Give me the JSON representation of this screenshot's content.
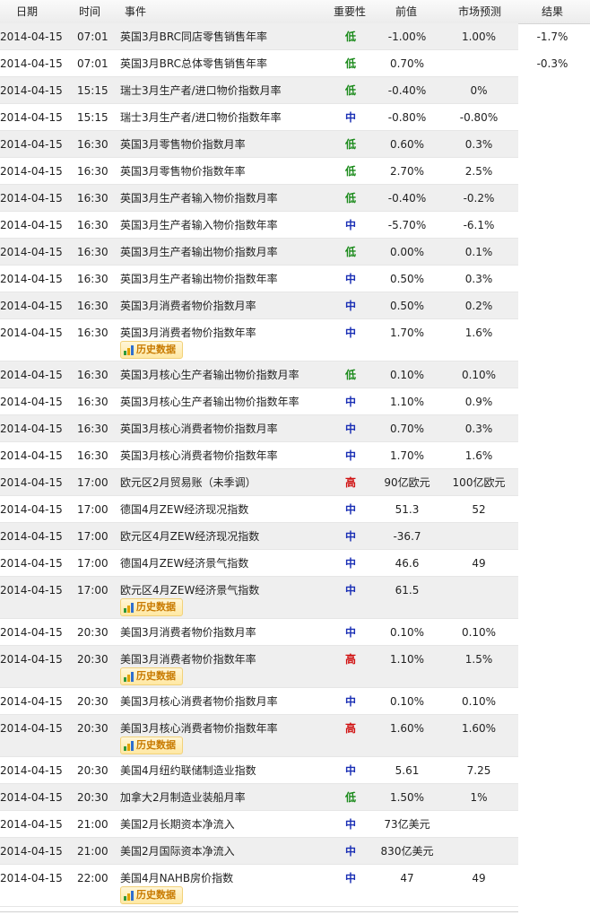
{
  "header": {
    "date": "日期",
    "time": "时间",
    "event": "事件",
    "importance": "重要性",
    "previous": "前值",
    "forecast": "市场预测",
    "result": "结果"
  },
  "history_label": "历史数据",
  "rows": [
    {
      "date": "2014-04-15",
      "time": "07:01",
      "event": "英国3月BRC同店零售销售年率",
      "importance": "低",
      "previous": "-1.00%",
      "forecast": "1.00%",
      "result": "-1.7%",
      "history": false
    },
    {
      "date": "2014-04-15",
      "time": "07:01",
      "event": "英国3月BRC总体零售销售年率",
      "importance": "低",
      "previous": "0.70%",
      "forecast": "",
      "result": "-0.3%",
      "history": false
    },
    {
      "date": "2014-04-15",
      "time": "15:15",
      "event": "瑞士3月生产者/进口物价指数月率",
      "importance": "低",
      "previous": "-0.40%",
      "forecast": "0%",
      "result": "",
      "history": false
    },
    {
      "date": "2014-04-15",
      "time": "15:15",
      "event": "瑞士3月生产者/进口物价指数年率",
      "importance": "中",
      "previous": "-0.80%",
      "forecast": "-0.80%",
      "result": "",
      "history": false
    },
    {
      "date": "2014-04-15",
      "time": "16:30",
      "event": "英国3月零售物价指数月率",
      "importance": "低",
      "previous": "0.60%",
      "forecast": "0.3%",
      "result": "",
      "history": false
    },
    {
      "date": "2014-04-15",
      "time": "16:30",
      "event": "英国3月零售物价指数年率",
      "importance": "低",
      "previous": "2.70%",
      "forecast": "2.5%",
      "result": "",
      "history": false
    },
    {
      "date": "2014-04-15",
      "time": "16:30",
      "event": "英国3月生产者输入物价指数月率",
      "importance": "低",
      "previous": "-0.40%",
      "forecast": "-0.2%",
      "result": "",
      "history": false
    },
    {
      "date": "2014-04-15",
      "time": "16:30",
      "event": "英国3月生产者输入物价指数年率",
      "importance": "中",
      "previous": "-5.70%",
      "forecast": "-6.1%",
      "result": "",
      "history": false
    },
    {
      "date": "2014-04-15",
      "time": "16:30",
      "event": "英国3月生产者输出物价指数月率",
      "importance": "低",
      "previous": "0.00%",
      "forecast": "0.1%",
      "result": "",
      "history": false
    },
    {
      "date": "2014-04-15",
      "time": "16:30",
      "event": "英国3月生产者输出物价指数年率",
      "importance": "中",
      "previous": "0.50%",
      "forecast": "0.3%",
      "result": "",
      "history": false
    },
    {
      "date": "2014-04-15",
      "time": "16:30",
      "event": "英国3月消费者物价指数月率",
      "importance": "中",
      "previous": "0.50%",
      "forecast": "0.2%",
      "result": "",
      "history": false
    },
    {
      "date": "2014-04-15",
      "time": "16:30",
      "event": "英国3月消费者物价指数年率",
      "importance": "中",
      "previous": "1.70%",
      "forecast": "1.6%",
      "result": "",
      "history": true
    },
    {
      "date": "2014-04-15",
      "time": "16:30",
      "event": "英国3月核心生产者输出物价指数月率",
      "importance": "低",
      "previous": "0.10%",
      "forecast": "0.10%",
      "result": "",
      "history": false
    },
    {
      "date": "2014-04-15",
      "time": "16:30",
      "event": "英国3月核心生产者输出物价指数年率",
      "importance": "中",
      "previous": "1.10%",
      "forecast": "0.9%",
      "result": "",
      "history": false
    },
    {
      "date": "2014-04-15",
      "time": "16:30",
      "event": "英国3月核心消费者物价指数月率",
      "importance": "中",
      "previous": "0.70%",
      "forecast": "0.3%",
      "result": "",
      "history": false
    },
    {
      "date": "2014-04-15",
      "time": "16:30",
      "event": "英国3月核心消费者物价指数年率",
      "importance": "中",
      "previous": "1.70%",
      "forecast": "1.6%",
      "result": "",
      "history": false
    },
    {
      "date": "2014-04-15",
      "time": "17:00",
      "event": "欧元区2月贸易账（未季调）",
      "importance": "高",
      "previous": "90亿欧元",
      "forecast": "100亿欧元",
      "result": "",
      "history": false
    },
    {
      "date": "2014-04-15",
      "time": "17:00",
      "event": "德国4月ZEW经济现况指数",
      "importance": "中",
      "previous": "51.3",
      "forecast": "52",
      "result": "",
      "history": false
    },
    {
      "date": "2014-04-15",
      "time": "17:00",
      "event": "欧元区4月ZEW经济现况指数",
      "importance": "中",
      "previous": "-36.7",
      "forecast": "",
      "result": "",
      "history": false
    },
    {
      "date": "2014-04-15",
      "time": "17:00",
      "event": "德国4月ZEW经济景气指数",
      "importance": "中",
      "previous": "46.6",
      "forecast": "49",
      "result": "",
      "history": false
    },
    {
      "date": "2014-04-15",
      "time": "17:00",
      "event": "欧元区4月ZEW经济景气指数",
      "importance": "中",
      "previous": "61.5",
      "forecast": "",
      "result": "",
      "history": true
    },
    {
      "date": "2014-04-15",
      "time": "20:30",
      "event": "美国3月消费者物价指数月率",
      "importance": "中",
      "previous": "0.10%",
      "forecast": "0.10%",
      "result": "",
      "history": false
    },
    {
      "date": "2014-04-15",
      "time": "20:30",
      "event": "美国3月消费者物价指数年率",
      "importance": "高",
      "previous": "1.10%",
      "forecast": "1.5%",
      "result": "",
      "history": true
    },
    {
      "date": "2014-04-15",
      "time": "20:30",
      "event": "美国3月核心消费者物价指数月率",
      "importance": "中",
      "previous": "0.10%",
      "forecast": "0.10%",
      "result": "",
      "history": false
    },
    {
      "date": "2014-04-15",
      "time": "20:30",
      "event": "美国3月核心消费者物价指数年率",
      "importance": "高",
      "previous": "1.60%",
      "forecast": "1.60%",
      "result": "",
      "history": true
    },
    {
      "date": "2014-04-15",
      "time": "20:30",
      "event": "美国4月纽约联储制造业指数",
      "importance": "中",
      "previous": "5.61",
      "forecast": "7.25",
      "result": "",
      "history": false
    },
    {
      "date": "2014-04-15",
      "time": "20:30",
      "event": "加拿大2月制造业装船月率",
      "importance": "低",
      "previous": "1.50%",
      "forecast": "1%",
      "result": "",
      "history": false
    },
    {
      "date": "2014-04-15",
      "time": "21:00",
      "event": "美国2月长期资本净流入",
      "importance": "中",
      "previous": "73亿美元",
      "forecast": "",
      "result": "",
      "history": false
    },
    {
      "date": "2014-04-15",
      "time": "21:00",
      "event": "美国2月国际资本净流入",
      "importance": "中",
      "previous": "830亿美元",
      "forecast": "",
      "result": "",
      "history": false
    },
    {
      "date": "2014-04-15",
      "time": "22:00",
      "event": "美国4月NAHB房价指数",
      "importance": "中",
      "previous": "47",
      "forecast": "49",
      "result": "",
      "history": true
    }
  ]
}
